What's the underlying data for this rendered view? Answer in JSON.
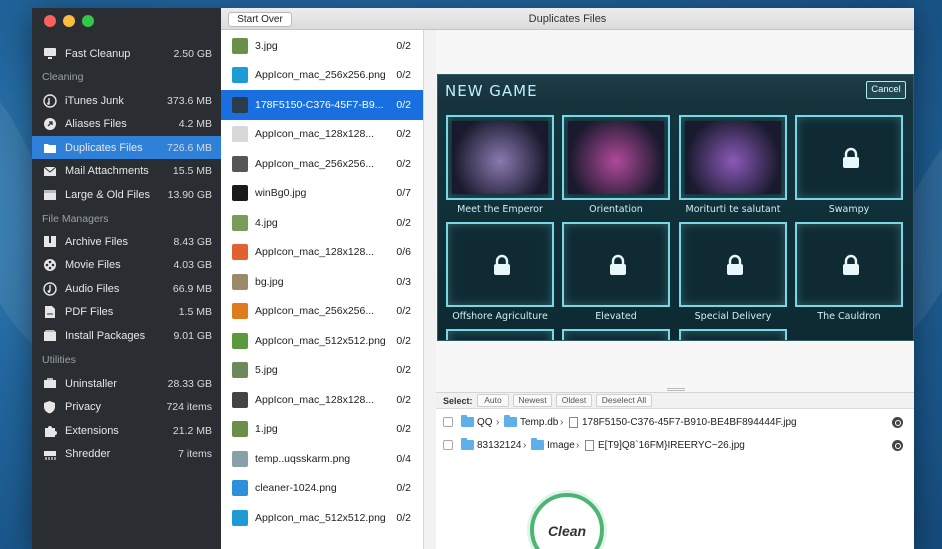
{
  "window": {
    "title": "Duplicates Files",
    "start_over_label": "Start Over"
  },
  "sidebar": {
    "top_item": {
      "label": "Fast Cleanup",
      "size": "2.50 GB",
      "icon": "monitor-icon"
    },
    "sections": [
      {
        "title": "Cleaning",
        "items": [
          {
            "label": "iTunes Junk",
            "size": "373.6 MB",
            "icon": "music-icon"
          },
          {
            "label": "Aliases Files",
            "size": "4.2 MB",
            "icon": "alias-icon"
          },
          {
            "label": "Duplicates Files",
            "size": "726.6 MB",
            "icon": "duplicates-icon",
            "active": true
          },
          {
            "label": "Mail Attachments",
            "size": "15.5 MB",
            "icon": "mail-icon"
          },
          {
            "label": "Large & Old Files",
            "size": "13.90 GB",
            "icon": "box-icon"
          }
        ]
      },
      {
        "title": "File Managers",
        "items": [
          {
            "label": "Archive Files",
            "size": "8.43 GB",
            "icon": "archive-icon"
          },
          {
            "label": "Movie Files",
            "size": "4.03 GB",
            "icon": "film-reel-icon"
          },
          {
            "label": "Audio Files",
            "size": "66.9 MB",
            "icon": "audio-icon"
          },
          {
            "label": "PDF Files",
            "size": "1.5 MB",
            "icon": "pdf-icon"
          },
          {
            "label": "Install Packages",
            "size": "9.01 GB",
            "icon": "package-icon"
          }
        ]
      },
      {
        "title": "Utilities",
        "items": [
          {
            "label": "Uninstaller",
            "size": "28.33 GB",
            "icon": "uninstaller-icon"
          },
          {
            "label": "Privacy",
            "size": "724 items",
            "icon": "shield-icon"
          },
          {
            "label": "Extensions",
            "size": "21.2 MB",
            "icon": "puzzle-icon"
          },
          {
            "label": "Shredder",
            "size": "7 items",
            "icon": "shredder-icon"
          }
        ]
      }
    ]
  },
  "files": [
    {
      "name": "3.jpg",
      "count": "0/2",
      "thumb": "#6a8f4a"
    },
    {
      "name": "AppIcon_mac_256x256.png",
      "count": "0/2",
      "thumb": "#1e9bd7"
    },
    {
      "name": "178F5150-C376-45F7-B9...",
      "count": "0/2",
      "thumb": "#2b3b4a",
      "selected": true
    },
    {
      "name": "AppIcon_mac_128x128...",
      "count": "0/2",
      "thumb": "#d8d8d8"
    },
    {
      "name": "AppIcon_mac_256x256...",
      "count": "0/2",
      "thumb": "#555555"
    },
    {
      "name": "winBg0.jpg",
      "count": "0/7",
      "thumb": "#1a1a1a"
    },
    {
      "name": "4.jpg",
      "count": "0/2",
      "thumb": "#7a9a5a"
    },
    {
      "name": "AppIcon_mac_128x128...",
      "count": "0/6",
      "thumb": "#e0622f"
    },
    {
      "name": "bg.jpg",
      "count": "0/3",
      "thumb": "#9a8a6a"
    },
    {
      "name": "AppIcon_mac_256x256...",
      "count": "0/2",
      "thumb": "#e07a1f"
    },
    {
      "name": "AppIcon_mac_512x512.png",
      "count": "0/2",
      "thumb": "#5a9a3a"
    },
    {
      "name": "5.jpg",
      "count": "0/2",
      "thumb": "#6a8a5a"
    },
    {
      "name": "AppIcon_mac_128x128...",
      "count": "0/2",
      "thumb": "#444444"
    },
    {
      "name": "1.jpg",
      "count": "0/2",
      "thumb": "#6a8f4a"
    },
    {
      "name": "temp..uqsskarm.png",
      "count": "0/4",
      "thumb": "#8aa0a8"
    },
    {
      "name": "cleaner-1024.png",
      "count": "0/2",
      "thumb": "#2b8fd9"
    },
    {
      "name": "AppIcon_mac_512x512.png",
      "count": "0/2",
      "thumb": "#1e9bd7"
    }
  ],
  "preview": {
    "game_title": "NEW GAME",
    "cancel_label": "Cancel",
    "tiles": [
      {
        "label": "Meet the Emperor",
        "locked": false,
        "color": "#8a7ab0"
      },
      {
        "label": "Orientation",
        "locked": false,
        "color": "#b04a9a"
      },
      {
        "label": "Moriturti te salutant",
        "locked": false,
        "color": "#8a5ab8"
      },
      {
        "label": "Swampy",
        "locked": true
      },
      {
        "label": "Offshore Agriculture",
        "locked": true
      },
      {
        "label": "Elevated",
        "locked": true
      },
      {
        "label": "Special Delivery",
        "locked": true
      },
      {
        "label": "The Cauldron",
        "locked": true
      }
    ]
  },
  "select_bar": {
    "label": "Select:",
    "buttons": [
      "Auto",
      "Newest",
      "Oldest",
      "Deselect All"
    ]
  },
  "paths": [
    {
      "parts": [
        "QQ",
        "Temp.db",
        "178F5150-C376-45F7-B910-BE4BF894444F.jpg"
      ]
    },
    {
      "parts": [
        "83132124",
        "Image",
        "E[T9]Q8`16FM}IREERYC~26.jpg"
      ]
    }
  ],
  "clean_label": "Clean",
  "colors": {
    "accent": "#1a6fe0",
    "sidebar_bg": "#2a2e33",
    "clean_ring": "#4bb673"
  }
}
